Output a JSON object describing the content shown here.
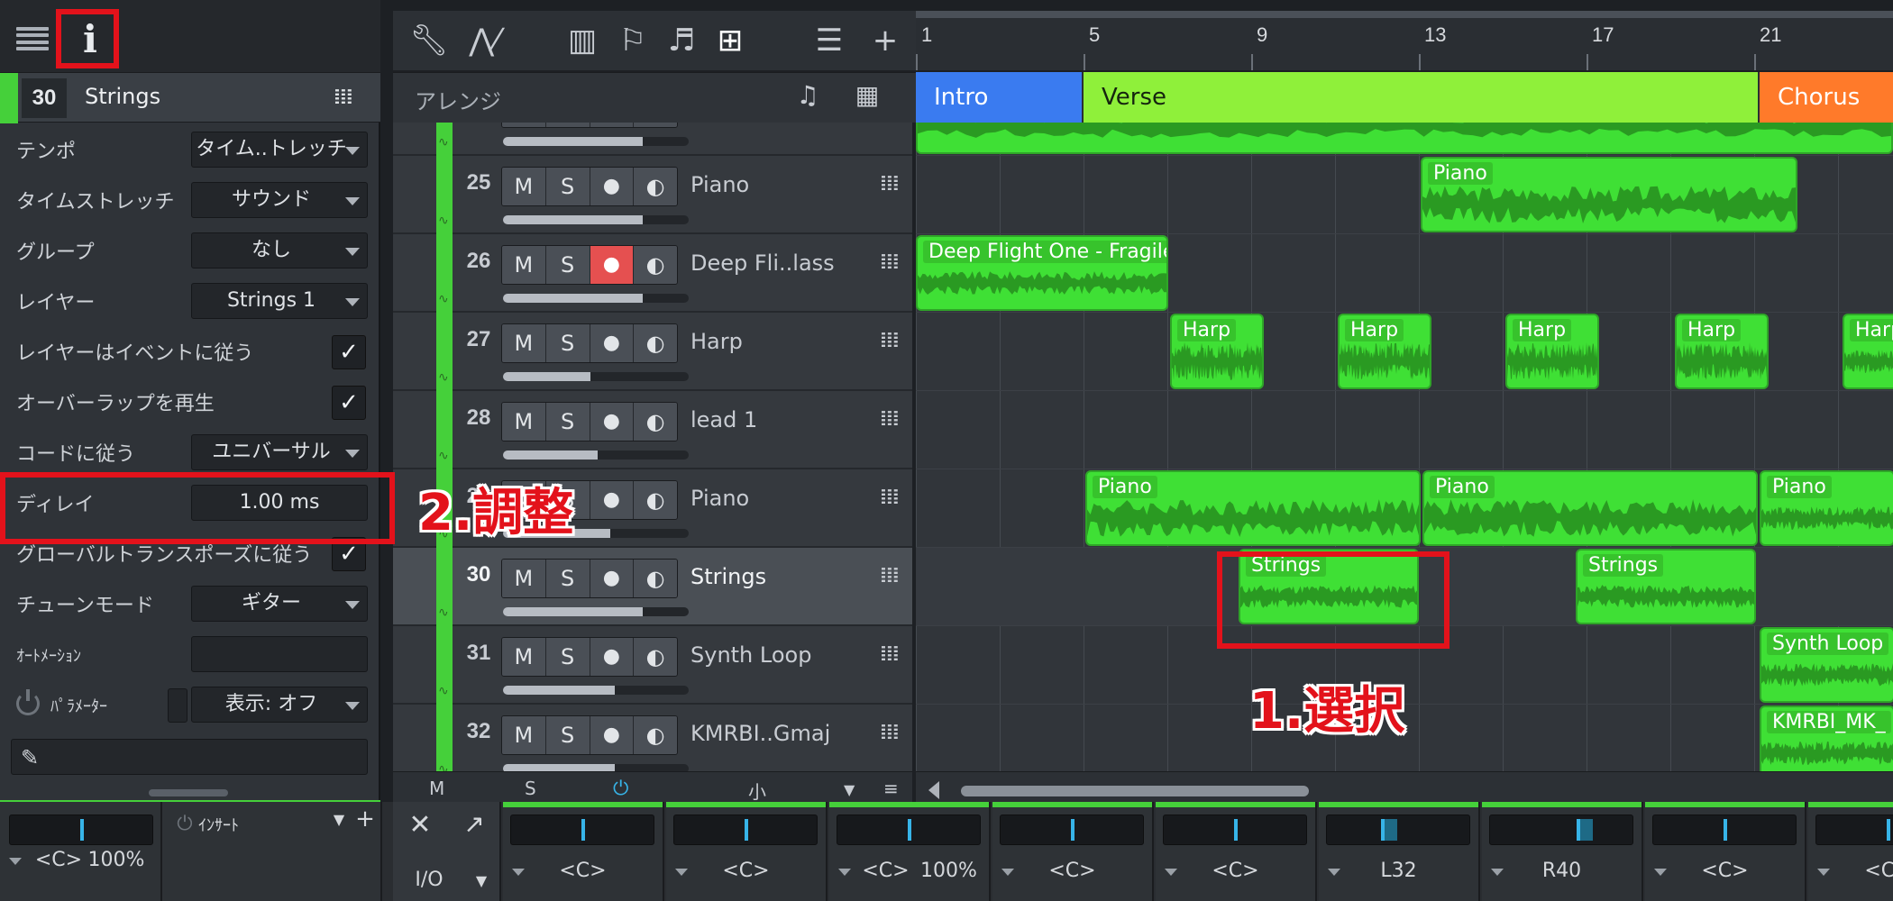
{
  "inspector": {
    "track_number": "30",
    "track_name": "Strings",
    "params": [
      {
        "label": "テンポ",
        "value": "タイム..トレッチ",
        "kind": "select"
      },
      {
        "label": "タイムストレッチ",
        "value": "サウンド",
        "kind": "select"
      },
      {
        "label": "グループ",
        "value": "なし",
        "kind": "select"
      },
      {
        "label": "レイヤー",
        "value": "Strings 1",
        "kind": "select"
      },
      {
        "label": "レイヤーはイベントに従う",
        "value": "✓",
        "kind": "check"
      },
      {
        "label": "オーバーラップを再生",
        "value": "✓",
        "kind": "check"
      },
      {
        "label": "コードに従う",
        "value": "ユニバーサル",
        "kind": "select"
      },
      {
        "label": "ディレイ",
        "value": "1.00 ms",
        "kind": "input"
      },
      {
        "label": "グローバルトランスポーズに従う",
        "value": "✓",
        "kind": "check"
      },
      {
        "label": "チューンモード",
        "value": "ギター",
        "kind": "select"
      },
      {
        "label": "ｵｰﾄﾒｰｼｮﾝ",
        "value": "",
        "kind": "input"
      },
      {
        "label": "ﾊﾟﾗﾒｰﾀｰ",
        "value": "表示: オフ",
        "kind": "select"
      }
    ],
    "insert_label": "ｲﾝｻｰﾄ",
    "pan_value": "<C>",
    "pan_percent": "100%"
  },
  "arrange": {
    "title": "アレンジ"
  },
  "tracks": [
    {
      "num": "",
      "name": "",
      "rec_on": false,
      "volume": 0.75,
      "partial": true
    },
    {
      "num": "25",
      "name": "Piano",
      "rec_on": false,
      "volume": 0.75
    },
    {
      "num": "26",
      "name": "Deep Fli..lass",
      "rec_on": true,
      "volume": 0.75
    },
    {
      "num": "27",
      "name": "Harp",
      "rec_on": false,
      "volume": 0.47
    },
    {
      "num": "28",
      "name": "lead 1",
      "rec_on": false,
      "volume": 0.51
    },
    {
      "num": "29",
      "name": "Piano",
      "rec_on": false,
      "volume": 0.58
    },
    {
      "num": "30",
      "name": "Strings",
      "rec_on": false,
      "volume": 0.75,
      "selected": true
    },
    {
      "num": "31",
      "name": "Synth Loop",
      "rec_on": false,
      "volume": 0.6
    },
    {
      "num": "32",
      "name": "KMRBI..Gmaj",
      "rec_on": false,
      "volume": 0.6
    }
  ],
  "track_buttons": {
    "mute": "M",
    "solo": "S",
    "rec": "●",
    "monitor": "◐"
  },
  "tracklist_footer": {
    "m": "M",
    "s": "S",
    "size": "小"
  },
  "ruler": {
    "bars": [
      "1",
      "5",
      "9",
      "13",
      "17",
      "21"
    ]
  },
  "sections": [
    {
      "name": "Intro",
      "color": "#3a7bf0"
    },
    {
      "name": "Verse",
      "color": "#8ff03a"
    },
    {
      "name": "Chorus",
      "color": "#ff7a2a"
    }
  ],
  "clips": {
    "piano25": "Piano",
    "deep26": "Deep Flight One - Fragile",
    "harp": "Harp",
    "piano29": "Piano",
    "strings": "Strings",
    "synth": "Synth Loop",
    "kmrbi": "KMRBI_MK_"
  },
  "console": {
    "io_label": "I/O",
    "strips": [
      {
        "val": "<C>",
        "pct": ""
      },
      {
        "val": "<C>",
        "pct": ""
      },
      {
        "val": "<C>",
        "pct": "100%"
      },
      {
        "val": "<C>",
        "pct": ""
      },
      {
        "val": "<C>",
        "pct": ""
      },
      {
        "val": "L32",
        "pct": ""
      },
      {
        "val": "R40",
        "pct": ""
      },
      {
        "val": "<C>",
        "pct": ""
      },
      {
        "val": "<C>",
        "pct": ""
      }
    ]
  },
  "annotations": {
    "step1": "1.選択",
    "step2": "2.調整"
  },
  "colors": {
    "clip_green": "#3fe035",
    "track_green": "#45d03a",
    "annotation_red": "#e3121b",
    "pan_blue": "#37b4e8"
  }
}
